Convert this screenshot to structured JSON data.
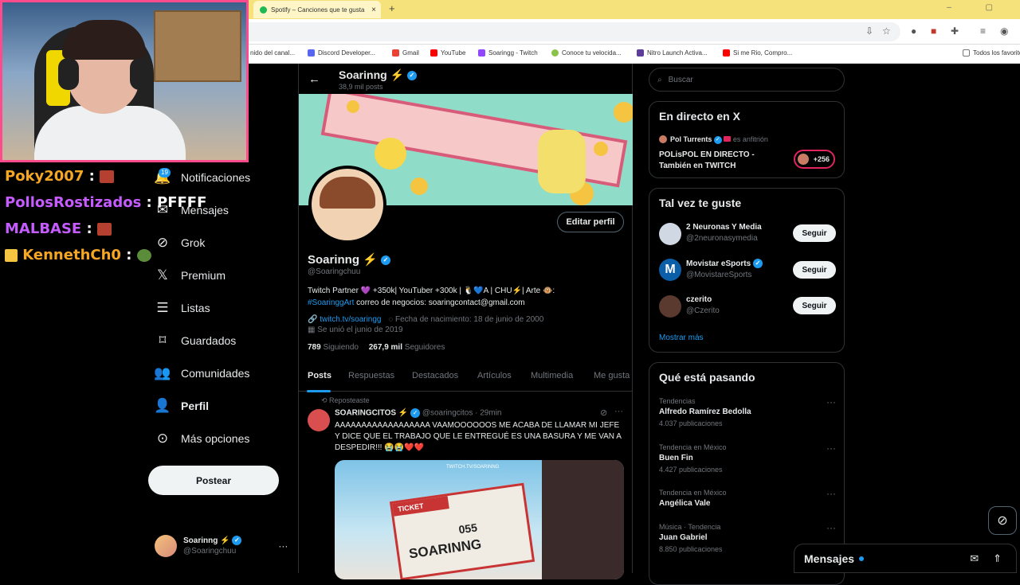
{
  "browser": {
    "tab_title": "Spotify – Canciones que te gusta",
    "tab_close": "×",
    "new_tab": "+",
    "bookmarks": [
      "nido del canal...",
      "Discord Developer...",
      "Gmail",
      "YouTube",
      "Soaringg - Twitch",
      "Conoce tu velocida...",
      "Nitro Launch Activa...",
      "Si me Rio, Compro...",
      "Todos los favoritos"
    ]
  },
  "chat_overlay": [
    {
      "user": "Poky2007",
      "msg": "",
      "color": "#f5a623"
    },
    {
      "user": "PollosRostizados",
      "msg": "PFFFF",
      "color": "#c65bff"
    },
    {
      "user": "MALBASE",
      "msg": "",
      "color": "#c65bff"
    },
    {
      "user": "KennethCh0",
      "msg": "",
      "color": "#f5a623"
    }
  ],
  "nav": {
    "items": [
      {
        "label": "Notificaciones",
        "icon": "bell-icon",
        "badge": "19"
      },
      {
        "label": "Mensajes",
        "icon": "mail-icon"
      },
      {
        "label": "Grok",
        "icon": "grok-icon"
      },
      {
        "label": "Premium",
        "icon": "x-logo-icon"
      },
      {
        "label": "Listas",
        "icon": "list-icon"
      },
      {
        "label": "Guardados",
        "icon": "bookmark-icon"
      },
      {
        "label": "Comunidades",
        "icon": "people-icon"
      },
      {
        "label": "Perfil",
        "icon": "person-icon"
      },
      {
        "label": "Más opciones",
        "icon": "more-circle-icon"
      }
    ],
    "post_button": "Postear",
    "account_name": "Soarinng ⚡",
    "account_handle": "@Soaringchuu",
    "account_more": "···"
  },
  "profile": {
    "header_name": "Soarinng ⚡",
    "header_posts": "38,9 mil posts",
    "edit_button": "Editar perfil",
    "name": "Soarinng ⚡",
    "handle": "@Soaringchuu",
    "bio_line1": "Twitch Partner 💜 +350k| YouTuber +300k | 🐧💙A | CHU⚡| Arte 🐵:",
    "bio_hashtag": "#SoaringgArt",
    "bio_line2": " correo de negocios: soaringcontact@gmail.com",
    "link": "twitch.tv/soaringg",
    "birthday": "Fecha de nacimiento: 18 de junio de 2000",
    "joined": "Se unió el junio de 2019",
    "following_count": "789",
    "following_label": "Siguiendo",
    "followers_count": "267,9 mil",
    "followers_label": "Seguidores",
    "tabs": [
      "Posts",
      "Respuestas",
      "Destacados",
      "Artículos",
      "Multimedia",
      "Me gusta"
    ]
  },
  "tweet": {
    "repost_label": "Reposteaste",
    "author": "SOARINGCITOS ⚡",
    "handle": "@soaringcitos",
    "time": "· 29min",
    "text": "AAAAAAAAAAAAAAAAAA VAAMOOOOOOS ME ACABA DE LLAMAR MI JEFE Y DICE QUE EL TRABAJO QUE LE ENTREGUÉ ES UNA BASURA Y ME VAN A DESPEDIR!!! 😭😭❤️❤️",
    "image_ticket_title": "TICKET",
    "image_ticket_number": "055",
    "image_ticket_name": "SOARINNG",
    "image_watermark": "TWITCH.TV/SOARINNG"
  },
  "right": {
    "search_placeholder": "Buscar",
    "live": {
      "title": "En directo en X",
      "host_name": "Pol Turrents",
      "host_role": "es anfitrión",
      "stream_title": "POLisPOL EN DIRECTO - También en TWITCH",
      "listeners": "+256"
    },
    "suggest": {
      "title": "Tal vez te guste",
      "items": [
        {
          "name": "2 Neuronas Y Media",
          "handle": "@2neuronasymedia",
          "button": "Seguir"
        },
        {
          "name": "Movistar eSports",
          "handle": "@MovistareSports",
          "button": "Seguir"
        },
        {
          "name": "czerito",
          "handle": "@Czerito",
          "button": "Seguir"
        }
      ],
      "more": "Mostrar más"
    },
    "trends": {
      "title": "Qué está pasando",
      "items": [
        {
          "context": "Tendencias",
          "topic": "Alfredo Ramírez Bedolla",
          "count": "4.037 publicaciones"
        },
        {
          "context": "Tendencia en México",
          "topic": "Buen Fin",
          "count": "4.427 publicaciones"
        },
        {
          "context": "Tendencia en México",
          "topic": "Angélica Vale",
          "count": ""
        },
        {
          "context": "Música · Tendencia",
          "topic": "Juan Gabriel",
          "count": "8.850 publicaciones"
        }
      ]
    },
    "messages_label": "Mensajes"
  },
  "colors": {
    "accent": "#1d9bf0",
    "background": "#000000",
    "border": "#2f3336",
    "tab_bar": "#f6e27a",
    "cam_border": "#ff4b8b"
  }
}
